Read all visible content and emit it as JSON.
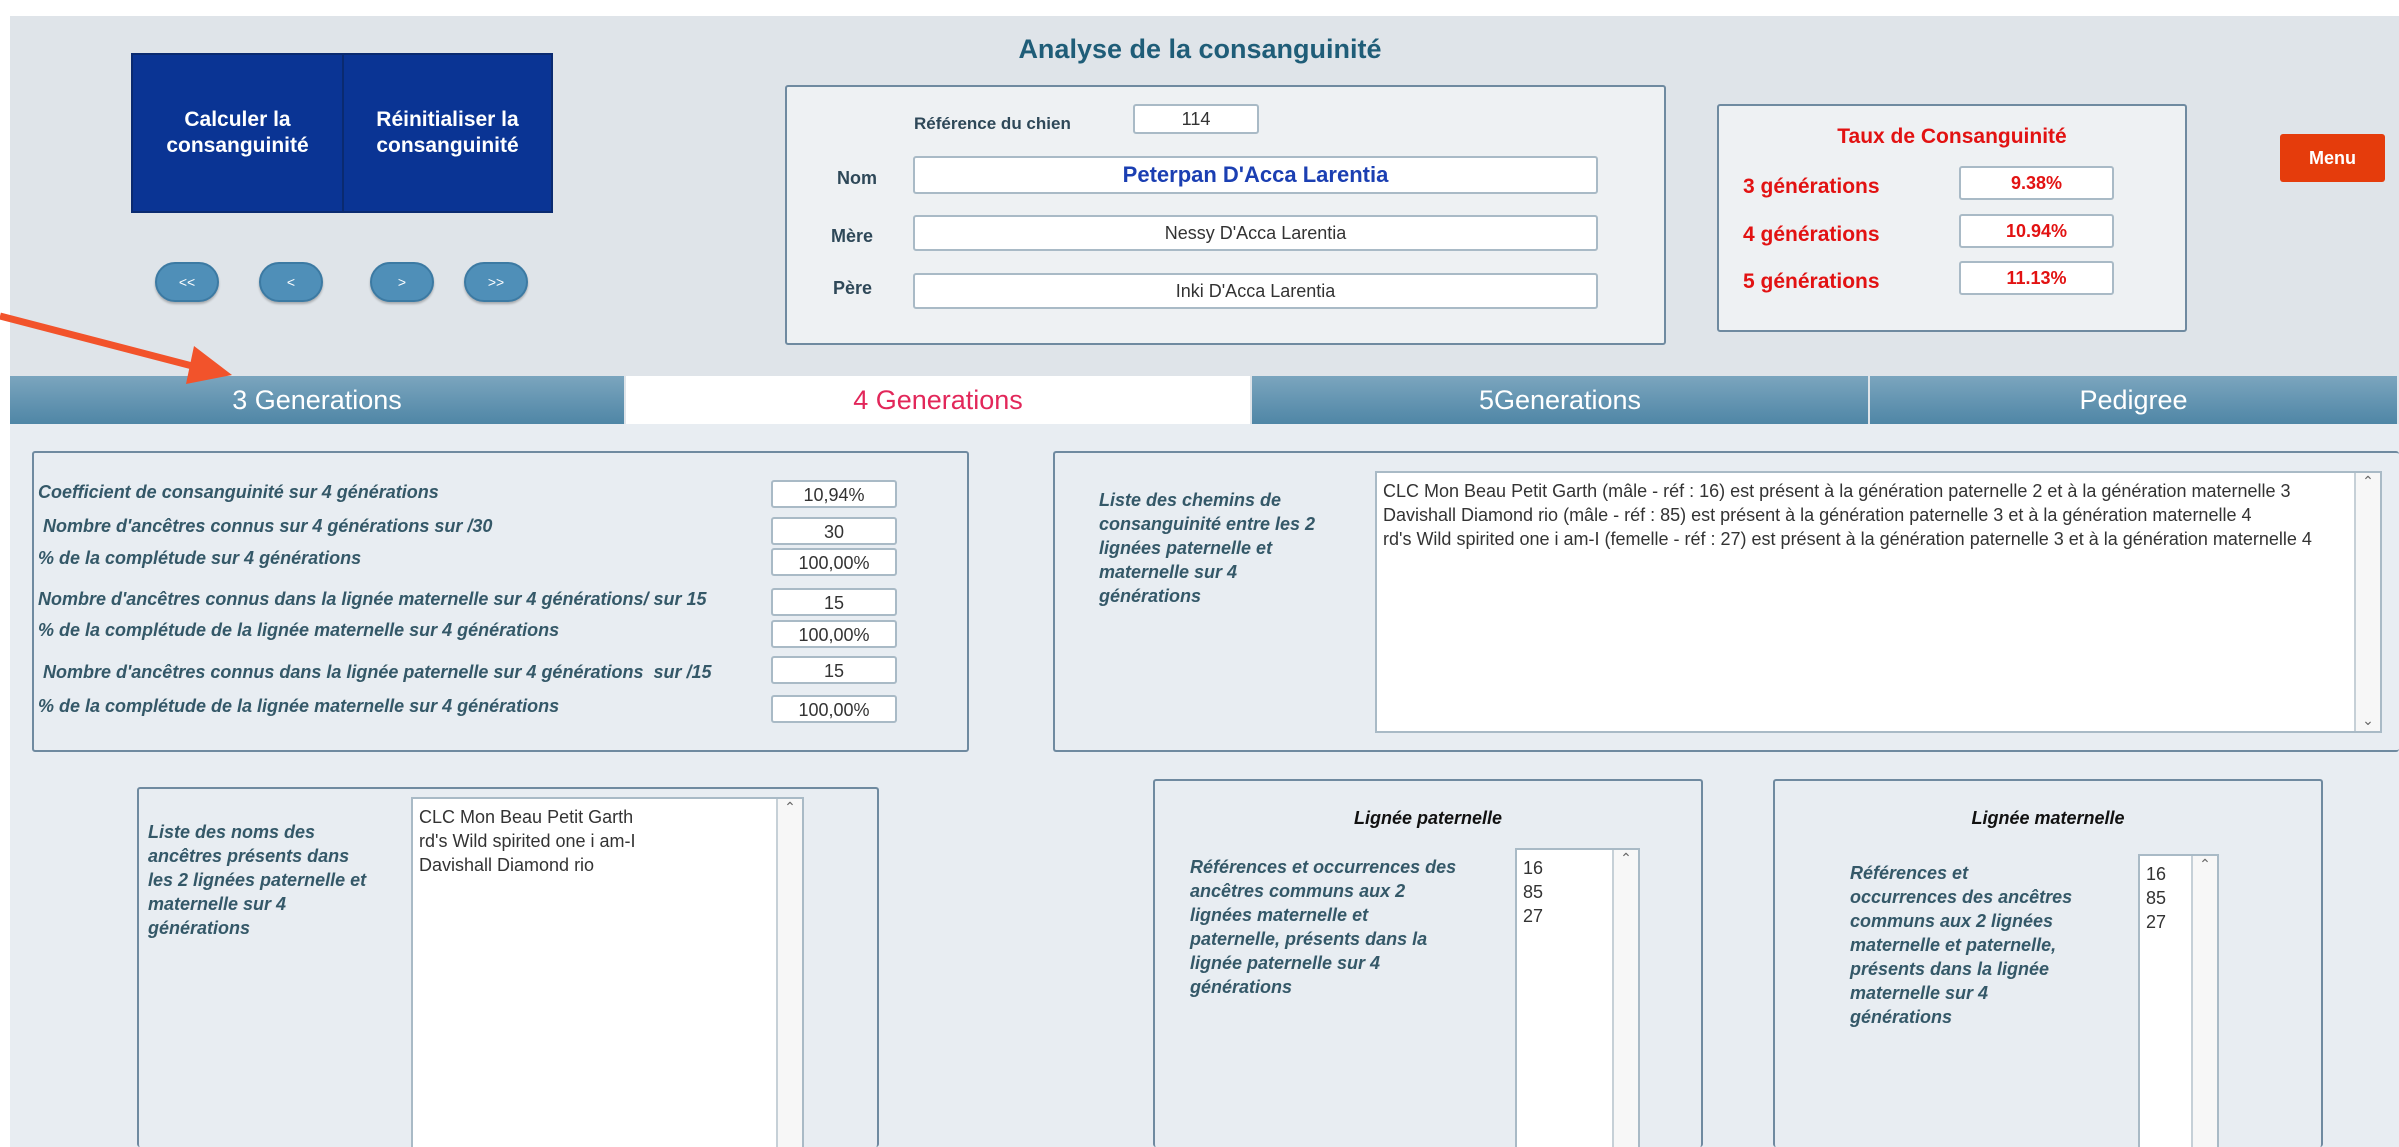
{
  "header": {
    "title": "Analyse de la consanguinité",
    "buttons": {
      "calculate": "Calculer la consanguinité",
      "reset": "Réinitialiser la consanguinité"
    },
    "nav": {
      "first": "<<",
      "prev": "<",
      "next": ">",
      "last": ">>"
    },
    "menu_label": "Menu"
  },
  "dog": {
    "reference_label": "Référence du chien",
    "reference_value": "114",
    "name_label": "Nom",
    "name_value": "Peterpan  D'Acca Larentia",
    "mother_label": "Mère",
    "mother_value": "Nessy  D'Acca Larentia",
    "father_label": "Père",
    "father_value": "Inki  D'Acca Larentia"
  },
  "rates": {
    "title": "Taux de Consanguinité",
    "rows": [
      {
        "label": "3 générations",
        "value": "9.38%"
      },
      {
        "label": "4 générations",
        "value": "10.94%"
      },
      {
        "label": "5 générations",
        "value": "11.13%"
      }
    ]
  },
  "tabs": [
    {
      "label": "3 Generations"
    },
    {
      "label": "4 Generations"
    },
    {
      "label": "5Generations"
    },
    {
      "label": "Pedigree"
    }
  ],
  "stats": [
    {
      "label": "Coefficient de consanguinité sur 4 générations",
      "value": "10,94%"
    },
    {
      "label": " Nombre d'ancêtres connus sur 4 générations sur /30",
      "value": "30"
    },
    {
      "label": "% de la complétude sur 4 générations",
      "value": "100,00%"
    },
    {
      "label": "Nombre d'ancêtres connus dans la lignée maternelle sur 4 générations/ sur 15",
      "value": "15"
    },
    {
      "label": "% de la complétude de la lignée maternelle sur 4 générations",
      "value": "100,00%"
    },
    {
      "label": " Nombre d'ancêtres connus dans la lignée paternelle sur 4 générations  sur /15",
      "value": "15"
    },
    {
      "label": "% de la complétude de la lignée maternelle sur 4 générations",
      "value": "100,00%"
    }
  ],
  "paths": {
    "label": "Liste des chemins de consanguinité entre les 2 lignées paternelle et maternelle sur 4 générations",
    "lines": [
      "CLC  Mon Beau Petit Garth (mâle - réf : 16) est présent à la génération paternelle 2 et à la génération maternelle 3",
      "Davishall  Diamond rio (mâle - réf : 85) est présent à la génération paternelle 3 et à la génération maternelle 4",
      "rd's Wild  spirited one i am-I (femelle - réf : 27) est présent à la génération paternelle 3 et à la génération maternelle 4"
    ]
  },
  "ancestors": {
    "label": "Liste des noms des ancêtres présents dans les 2 lignées paternelle et maternelle sur 4 générations",
    "names": [
      "CLC  Mon Beau Petit Garth",
      "rd's Wild  spirited one i am-I",
      "Davishall  Diamond rio"
    ]
  },
  "paternal": {
    "title": "Lignée paternelle",
    "label": "Références et occurrences des ancêtres communs aux 2 lignées maternelle et paternelle, présents dans la lignée paternelle sur 4 générations",
    "refs": [
      "16",
      "85",
      "27"
    ]
  },
  "maternal": {
    "title": "Lignée maternelle",
    "label": "Références et occurrences des ancêtres communs aux 2 lignées maternelle et paternelle, présents dans la lignée maternelle sur 4 générations",
    "refs": [
      "16",
      "85",
      "27"
    ]
  },
  "colors": {
    "accent_red": "#e21212",
    "button_blue": "#0a3494",
    "menu_orange": "#e53c0c",
    "active_tab": "#e2275a",
    "annotation_arrow": "#f2532b"
  }
}
